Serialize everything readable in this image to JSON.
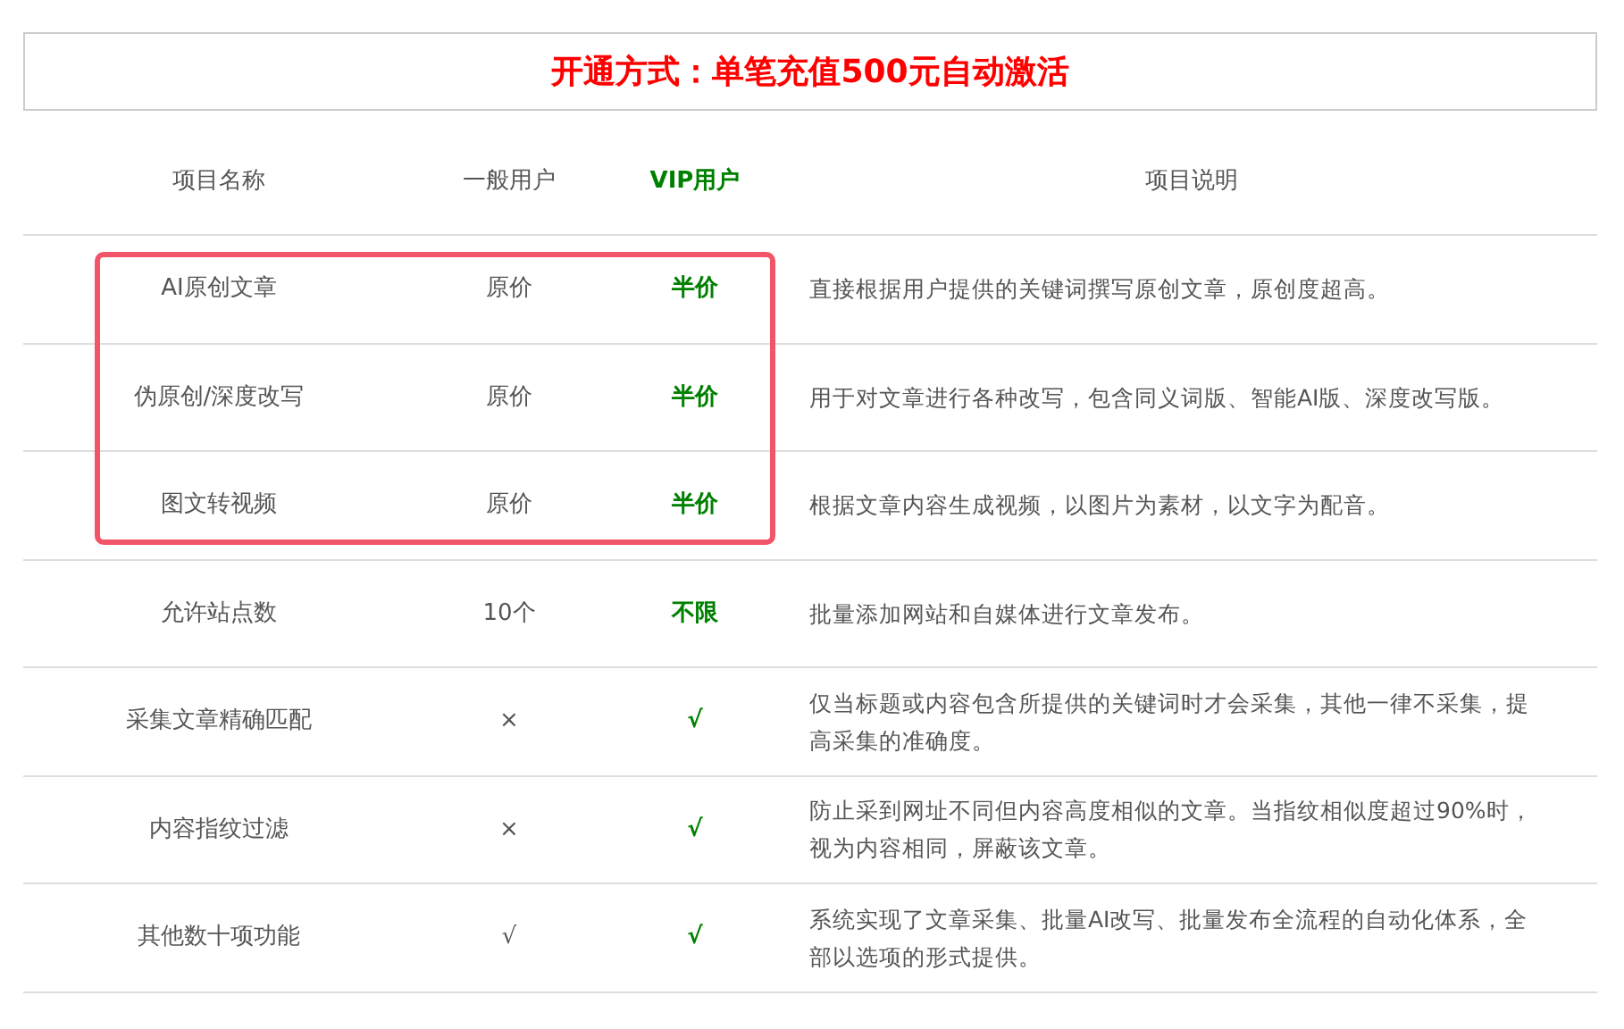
{
  "banner": "开通方式：单笔充值500元自动激活",
  "columns": [
    "项目名称",
    "一般用户",
    "VIP用户",
    "项目说明"
  ],
  "rows": [
    {
      "name": "AI原创文章",
      "general": "原价",
      "vip": "半价",
      "description": "直接根据用户提供的关键词撰写原创文章，原创度超高。",
      "highlighted": true
    },
    {
      "name": "伪原创/深度改写",
      "general": "原价",
      "vip": "半价",
      "description": "用于对文章进行各种改写，包含同义词版、智能AI版、深度改写版。",
      "highlighted": true
    },
    {
      "name": "图文转视频",
      "general": "原价",
      "vip": "半价",
      "description": "根据文章内容生成视频，以图片为素材，以文字为配音。",
      "highlighted": true
    },
    {
      "name": "允许站点数",
      "general": "10个",
      "vip": "不限",
      "description": "批量添加网站和自媒体进行文章发布。",
      "highlighted": false
    },
    {
      "name": "采集文章精确匹配",
      "general": "×",
      "vip": "√",
      "description": "仅当标题或内容包含所提供的关键词时才会采集，其他一律不采集，提高采集的准确度。",
      "highlighted": false
    },
    {
      "name": "内容指纹过滤",
      "general": "×",
      "vip": "√",
      "description": "防止采到网址不同但内容高度相似的文章。当指纹相似度超过90%时，视为内容相同，屏蔽该文章。",
      "highlighted": false
    },
    {
      "name": "其他数十项功能",
      "general": "√",
      "vip": "√",
      "description": "系统实现了文章采集、批量AI改写、批量发布全流程的自动化体系，全部以选项的形式提供。",
      "highlighted": false
    }
  ]
}
